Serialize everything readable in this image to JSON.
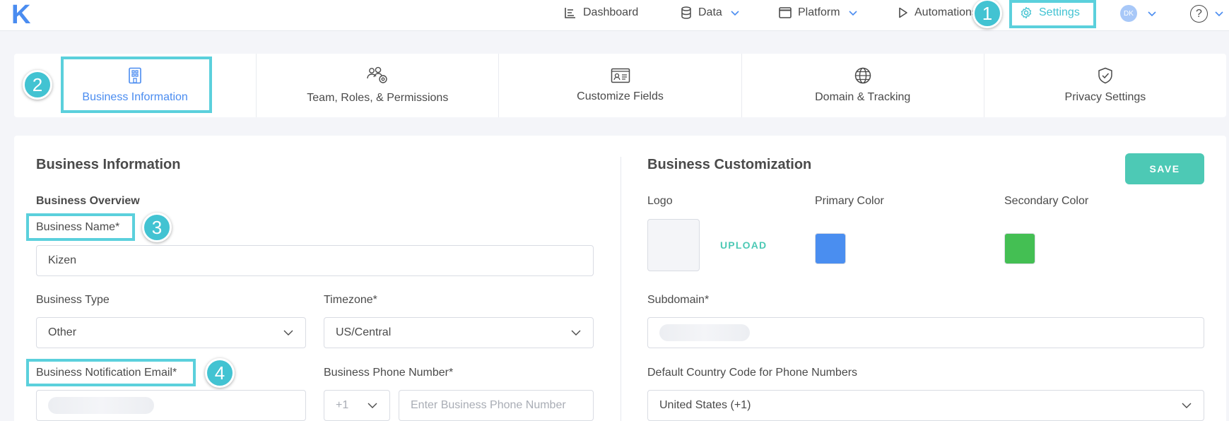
{
  "app": {
    "logo_letter": "K"
  },
  "nav": {
    "dashboard": "Dashboard",
    "data": "Data",
    "platform": "Platform",
    "automations": "Automations",
    "settings": "Settings",
    "avatar_initials": "DK",
    "help": "?"
  },
  "steps": [
    "1",
    "2",
    "3",
    "4"
  ],
  "tabs": [
    {
      "label": "Business Information",
      "icon": "building-icon",
      "active": true
    },
    {
      "label": "Team, Roles, & Permissions",
      "icon": "team-gear-icon",
      "active": false
    },
    {
      "label": "Customize Fields",
      "icon": "id-card-icon",
      "active": false
    },
    {
      "label": "Domain & Tracking",
      "icon": "globe-icon",
      "active": false
    },
    {
      "label": "Privacy Settings",
      "icon": "shield-check-icon",
      "active": false
    }
  ],
  "business_info": {
    "title": "Business Information",
    "overview_label": "Business Overview",
    "name_label": "Business Name*",
    "name_value": "Kizen",
    "type_label": "Business Type",
    "type_value": "Other",
    "timezone_label": "Timezone*",
    "timezone_value": "US/Central",
    "email_label": "Business Notification Email*",
    "phone_label": "Business Phone Number*",
    "phone_code": "+1",
    "phone_placeholder": "Enter Business Phone Number"
  },
  "customization": {
    "title": "Business Customization",
    "save_label": "SAVE",
    "logo_label": "Logo",
    "upload_label": "UPLOAD",
    "primary_label": "Primary Color",
    "primary_color": "#4a8ef0",
    "secondary_label": "Secondary Color",
    "secondary_color": "#44bf53",
    "subdomain_label": "Subdomain*",
    "country_code_label": "Default Country Code for Phone Numbers",
    "country_code_value": "United States (+1)"
  },
  "colors": {
    "accent": "#4a8cf0",
    "highlight": "#5bd0dc",
    "save": "#4dc9b5"
  }
}
